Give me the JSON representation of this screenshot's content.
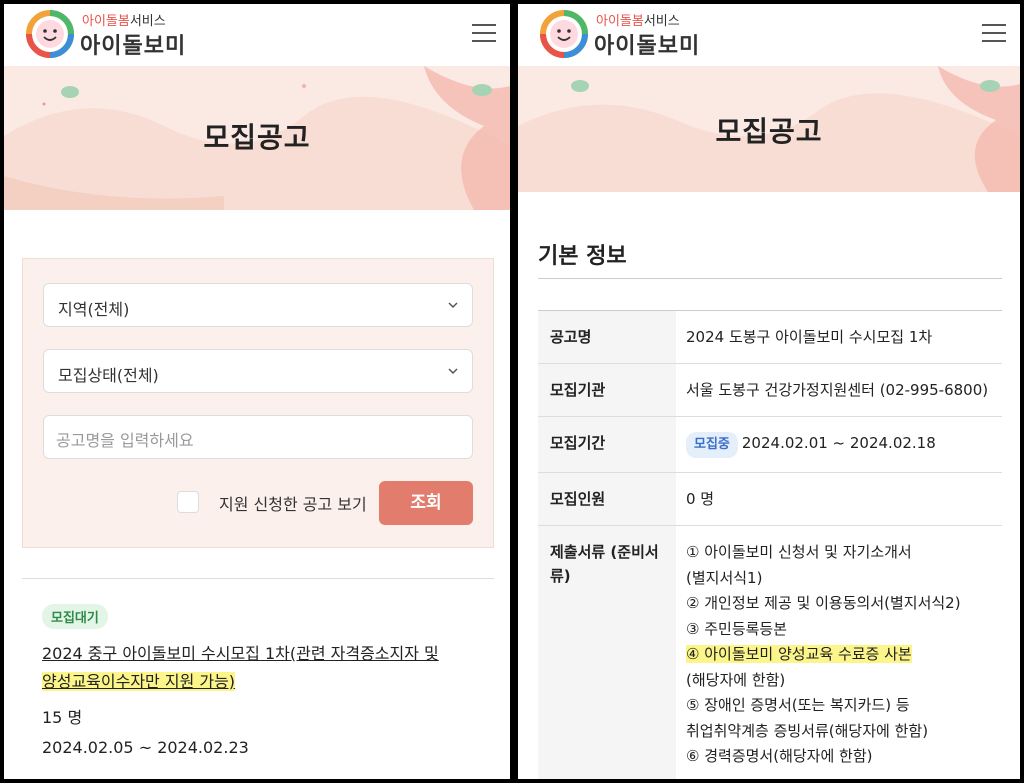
{
  "brand": {
    "sub_pink": "아이돌봄",
    "sub_rest": "서비스",
    "main": "아이돌보미"
  },
  "banner": {
    "title": "모집공고"
  },
  "left": {
    "region_select": "지역(전체)",
    "status_select": "모집상태(전체)",
    "search_placeholder": "공고명을 입력하세요",
    "checkbox_label": "지원 신청한 공고 보기",
    "search_button": "조회",
    "post": {
      "badge": "모집대기",
      "title_part1": "2024 중구 아이돌보미 수시모집 1차(관련 자격증소지자 및",
      "title_part2": "양성교육이수자만 지원 가능)",
      "count": "15 명",
      "date": "2024.02.05 ~ 2024.02.23"
    }
  },
  "right": {
    "section_title": "기본 정보",
    "rows": [
      {
        "label": "공고명",
        "value": "2024 도봉구 아이돌보미 수시모집 1차"
      },
      {
        "label": "모집기관",
        "value": "서울 도봉구 건강가정지원센터 (02-995-6800)"
      },
      {
        "label": "모집기간",
        "badge": "모집중",
        "value": "2024.02.01 ~ 2024.02.18"
      },
      {
        "label": "모집인원",
        "value": "0 명"
      },
      {
        "label": "제출서류 (준비서류)"
      }
    ],
    "documents": [
      "① 아이돌보미 신청서 및 자기소개서",
      "(별지서식1)",
      "② 개인정보 제공 및 이용동의서(별지서식2)",
      "③ 주민등록등본",
      "④ 아이돌보미 양성교육 수료증 사본",
      "(해당자에 한함)",
      "⑤ 장애인 증명서(또는 복지카드) 등",
      "취업취약계층 증빙서류(해당자에 한함)",
      "⑥ 경력증명서(해당자에 한함)"
    ]
  },
  "colors": {
    "accent": "#e27d6d",
    "highlight": "#fbf58a",
    "banner_bg": "#fbe9e3"
  }
}
